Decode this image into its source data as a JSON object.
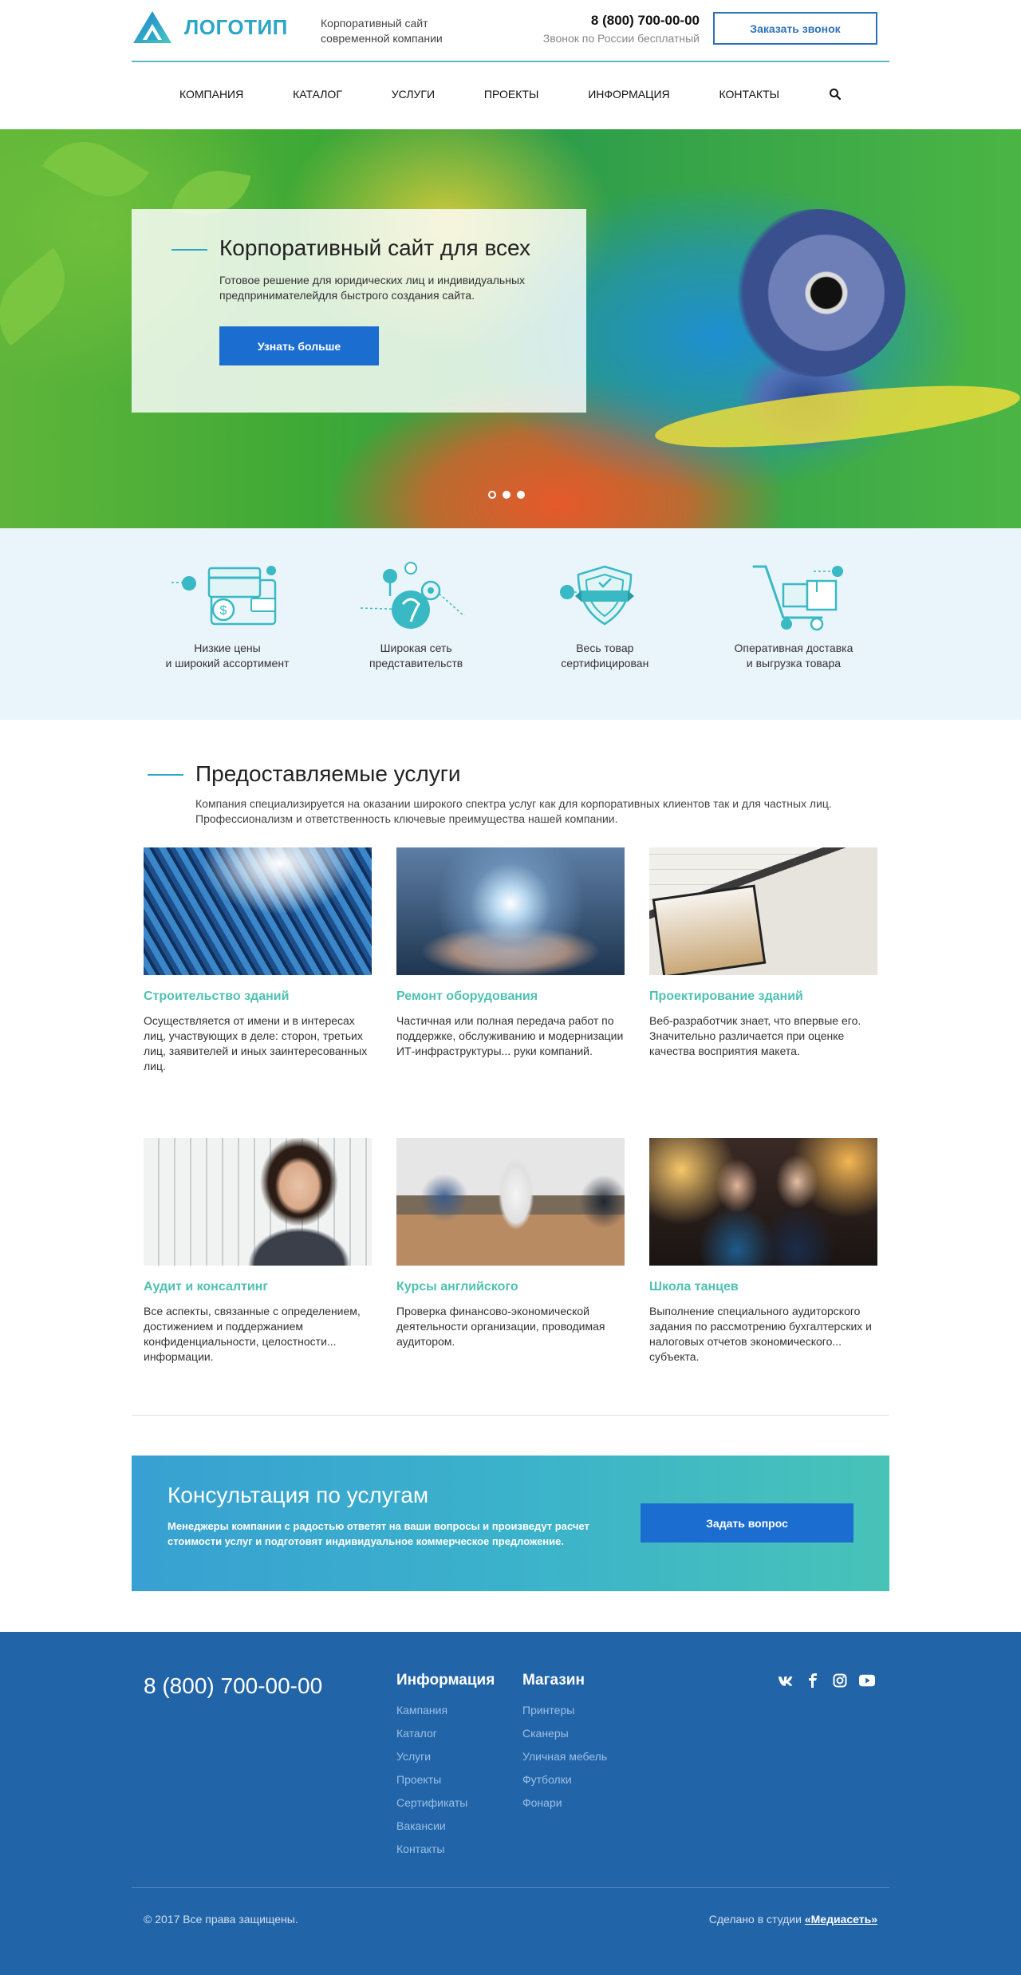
{
  "header": {
    "logo_text": "ЛОГОТИП",
    "tagline": "Корпоративный сайт современной компании",
    "phone": "8 (800) 700-00-00",
    "phone_note": "Звонок по России бесплатный",
    "callback_label": "Заказать звонок"
  },
  "nav": {
    "items": [
      "КОМПАНИЯ",
      "КАТАЛОГ",
      "УСЛУГИ",
      "ПРОЕКТЫ",
      "ИНФОРМАЦИЯ",
      "КОНТАКТЫ"
    ],
    "search_icon": "search-icon"
  },
  "hero": {
    "title": "Корпоративный сайт для всех",
    "text": "Готовое решение для юридических лиц и индивидуальных предпринимателейдля быстрого создания сайта.",
    "button": "Узнать больше",
    "slides": 3,
    "active_slide": 3
  },
  "features": [
    {
      "icon": "wallet-icon",
      "text": "Низкие цены\nи широкий ассортимент"
    },
    {
      "icon": "map-pin-icon",
      "text": "Широкая сеть\nпредставительств"
    },
    {
      "icon": "shield-certificate-icon",
      "text": "Весь товар\nсертифицирован"
    },
    {
      "icon": "delivery-cart-icon",
      "text": "Оперативная доставка\nи выгрузка товара"
    }
  ],
  "services": {
    "title": "Предоставляемые услуги",
    "description": "Компания специализируется на оказании широкого спектра услуг как для корпоративных клиентов так и для частных лиц. Профессионализм и ответственность ключевые преимущества нашей компании.",
    "cards": [
      {
        "title": "Строительство зданий",
        "text": "Осуществляется от имени и в интересах лиц, участвующих в деле: сторон, третьих лиц, заявителей и иных заинтересованных лиц."
      },
      {
        "title": "Ремонт оборудования",
        "text": "Частичная или полная передача работ по поддержке, обслуживанию и модернизации ИТ-инфраструктуры... руки компаний."
      },
      {
        "title": "Проектирование зданий",
        "text": "Веб-разработчик знает, что впервые его. Значительно различается при оценке качества восприятия макета."
      },
      {
        "title": "Аудит и консалтинг",
        "text": "Все аспекты, связанные с определением, достижением и поддержанием конфиденциальности, целостности... информации."
      },
      {
        "title": "Курсы английского",
        "text": "Проверка финансово-экономической деятельности организации, проводимая аудитором."
      },
      {
        "title": "Школа танцев",
        "text": "Выполнение специального аудиторского задания по рассмотрению бухгалтерских и налоговых отчетов экономического... субъекта."
      }
    ]
  },
  "cta": {
    "title": "Консультация по услугам",
    "text": "Менеджеры компании с радостью ответят на ваши вопросы и произведут расчет стоимости услуг и подготовят индивидуальное коммерческое предложение.",
    "button": "Задать вопрос"
  },
  "footer": {
    "phone": "8 (800) 700-00-00",
    "info_title": "Информация",
    "info_links": [
      "Кампания",
      "Каталог",
      "Услуги",
      "Проекты",
      "Сертификаты",
      "Вакансии",
      "Контакты"
    ],
    "shop_title": "Магазин",
    "shop_links": [
      "Принтеры",
      "Сканеры",
      "Уличная мебель",
      "Футболки",
      "Фонари"
    ],
    "social": [
      "vk-icon",
      "facebook-icon",
      "instagram-icon",
      "youtube-icon"
    ],
    "copyright": "© 2017 Все права защищены.",
    "made_by_prefix": "Сделано в студии",
    "made_by_link": "«Медиасеть»"
  },
  "colors": {
    "accent": "#2aa6c6",
    "primary_button": "#1b6dcf",
    "card_title": "#4fc1b2",
    "footer_bg": "#2264a8",
    "features_bg": "#eaf4fb"
  }
}
